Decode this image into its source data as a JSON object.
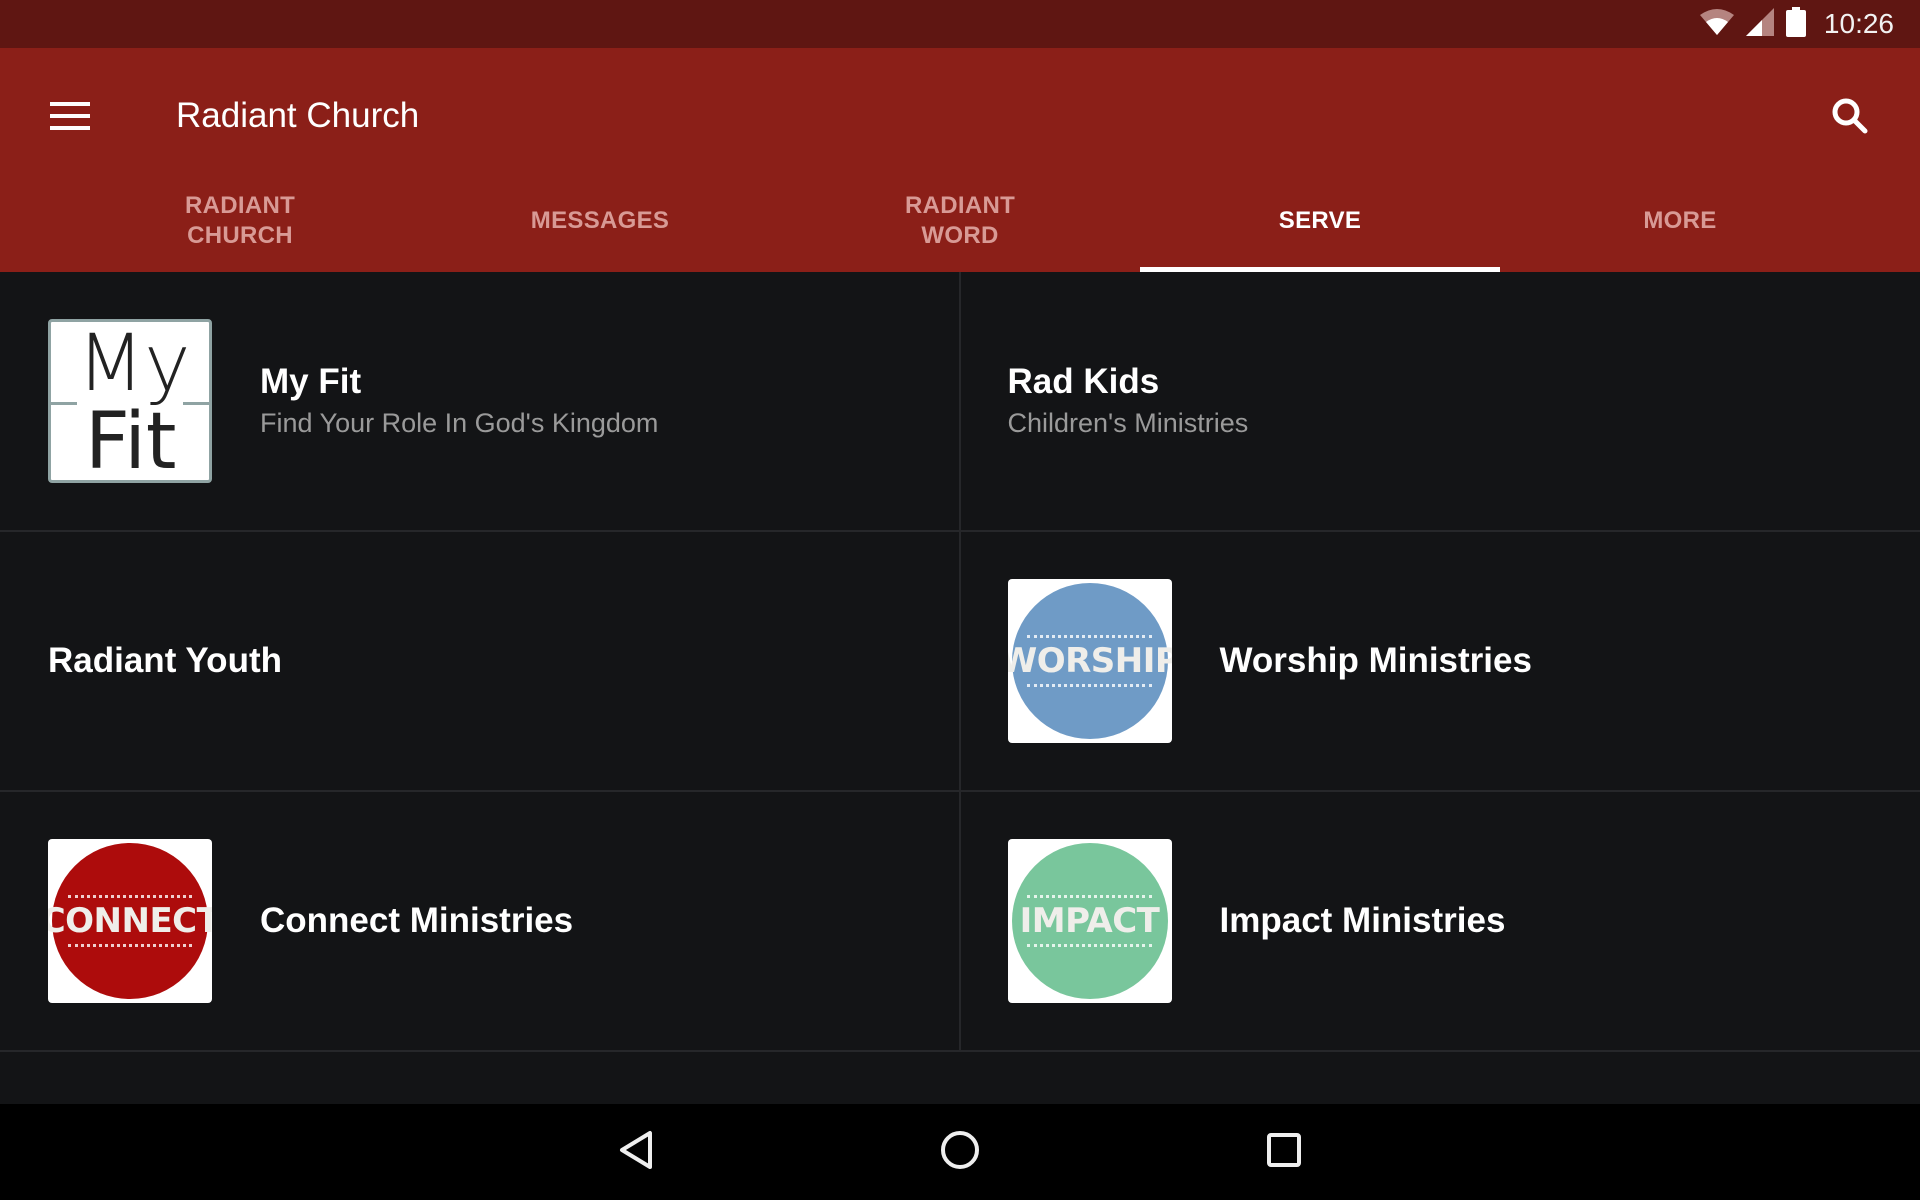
{
  "status_bar": {
    "time": "10:26",
    "icons": [
      "wifi-icon",
      "cellular-signal-icon",
      "battery-icon"
    ]
  },
  "app_bar": {
    "title": "Radiant Church",
    "menu_icon": "hamburger-menu-icon",
    "search_icon": "search-icon"
  },
  "tabs": [
    {
      "label": "Radiant Church",
      "active": false
    },
    {
      "label": "Messages",
      "active": false
    },
    {
      "label": "Radiant Word",
      "active": false
    },
    {
      "label": "Serve",
      "active": true
    },
    {
      "label": "More",
      "active": false
    }
  ],
  "items": [
    {
      "title": "My Fit",
      "subtitle": "Find Your Role In God's Kingdom",
      "thumb": {
        "type": "myfit",
        "line1": "My",
        "line2": "Fit"
      }
    },
    {
      "title": "Rad Kids",
      "subtitle": "Children's Ministries"
    },
    {
      "title": "Radiant Youth"
    },
    {
      "title": "Worship Ministries",
      "thumb": {
        "type": "badge",
        "word": "WORSHIP",
        "color": "#6f9bc6"
      }
    },
    {
      "title": "Connect Ministries",
      "thumb": {
        "type": "badge",
        "word": "CONNECT",
        "color": "#ad0c0c"
      }
    },
    {
      "title": "Impact Ministries",
      "thumb": {
        "type": "badge",
        "word": "IMPACT",
        "color": "#79c69c"
      }
    }
  ],
  "colors": {
    "status_bar": "#5f1612",
    "app_bar": "#8b1f18",
    "background": "#131416",
    "tab_inactive": "#d89a95",
    "tab_active": "#ffffff"
  },
  "nav_bar": {
    "back_icon": "back-icon",
    "home_icon": "home-icon",
    "recents_icon": "recents-icon"
  }
}
